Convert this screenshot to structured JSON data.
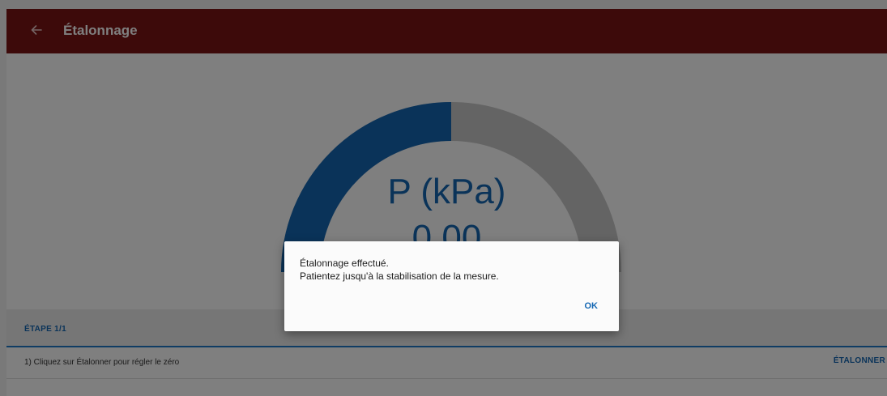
{
  "appbar": {
    "title": "Étalonnage",
    "back_icon": "arrow-left-icon",
    "color": "#7a1414"
  },
  "gauge": {
    "title": "P (kPa)",
    "value": "0.00",
    "fill_fraction": 0.5,
    "fill_color": "#1467b3",
    "track_color": "#c8c8c8"
  },
  "step": {
    "header": "ÉTAPE 1/1",
    "instruction": "1) Cliquez sur Étalonner pour régler le zéro",
    "action_label": "ÉTALONNER"
  },
  "dialog": {
    "line1": "Étalonnage effectué.",
    "line2": "Patientez jusqu'à la stabilisation de la mesure.",
    "ok_label": "OK"
  }
}
